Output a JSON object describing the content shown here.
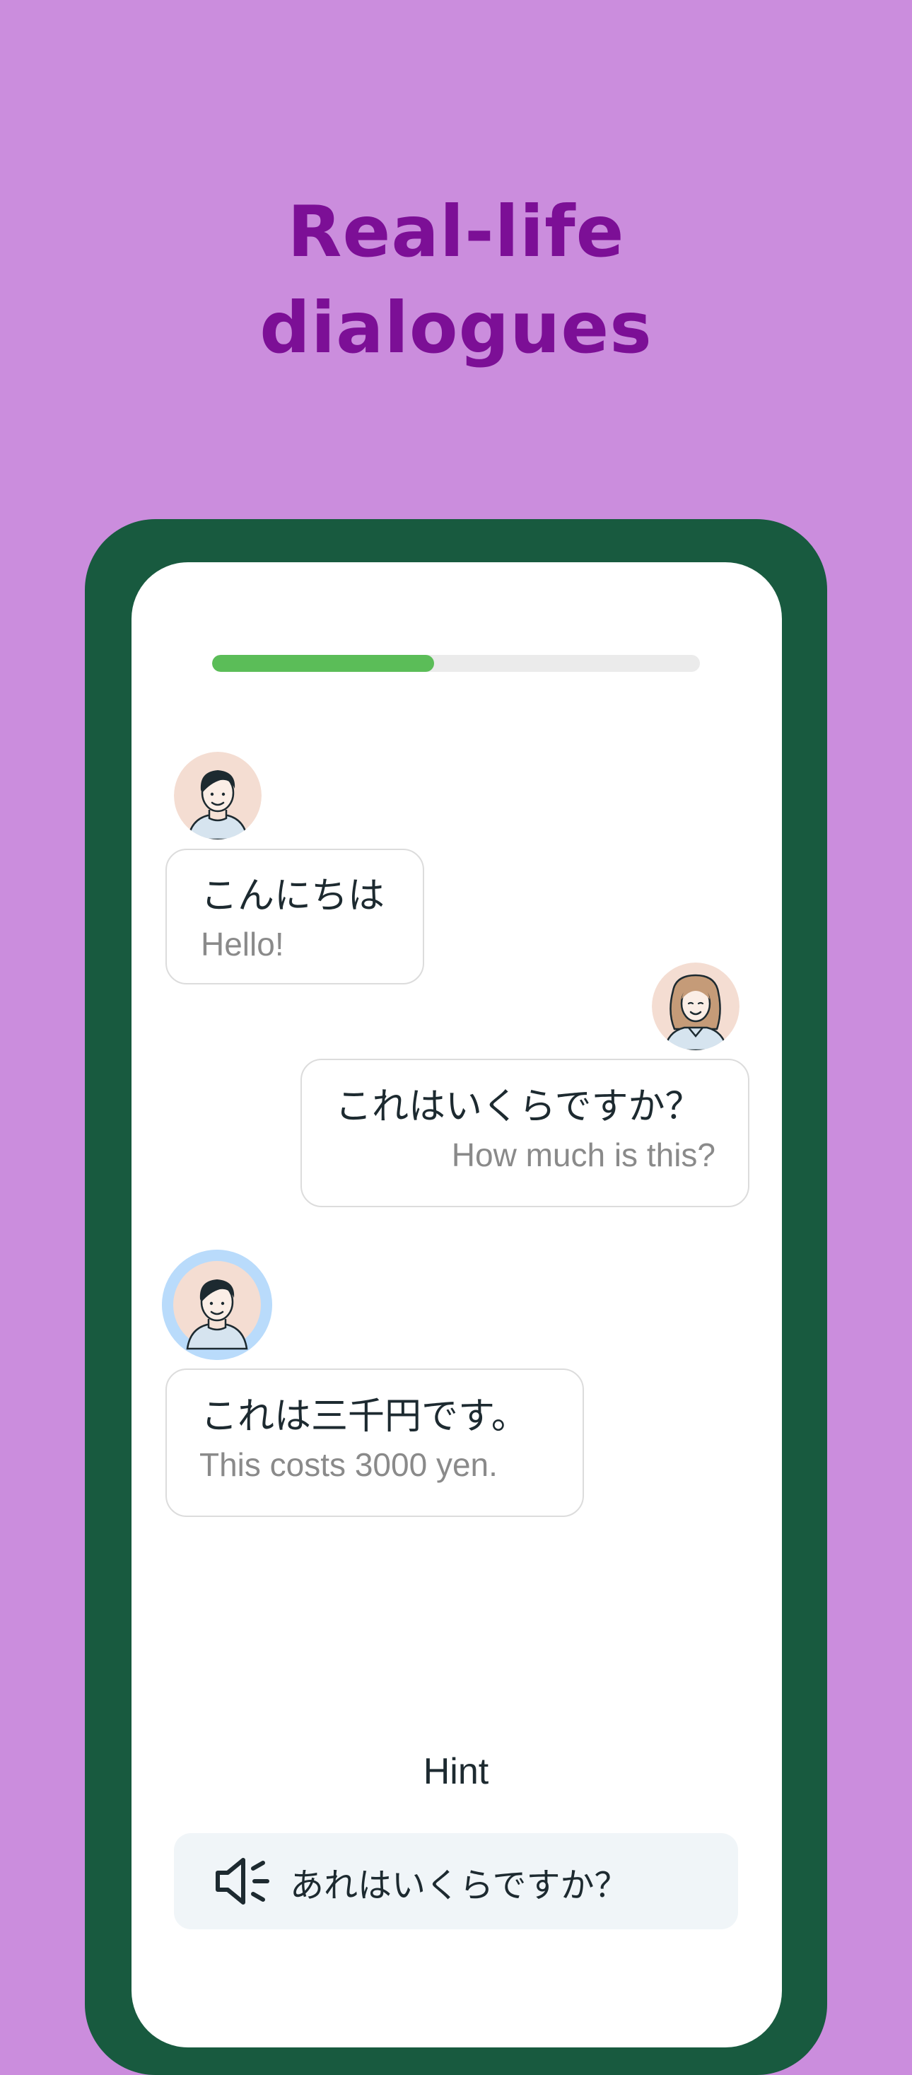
{
  "headline": {
    "line1": "Real-life",
    "line2": "dialogues"
  },
  "progress": {
    "fraction": 0.455
  },
  "messages": [
    {
      "speaker": "man",
      "japanese": "こんにちは",
      "english": "Hello!"
    },
    {
      "speaker": "woman",
      "japanese": "これはいくらですか？",
      "english": "How much is this?"
    },
    {
      "speaker": "man",
      "japanese": "これは三千円です。",
      "english": "This costs 3000 yen."
    }
  ],
  "hint": {
    "label": "Hint",
    "text": "あれはいくらですか？",
    "icon": "speaker-icon"
  },
  "colors": {
    "background": "#cb8ddd",
    "headline": "#7c0f96",
    "phone_frame": "#185a3f",
    "progress": "#5bbd58",
    "active_avatar_ring": "#b9dbfb"
  }
}
